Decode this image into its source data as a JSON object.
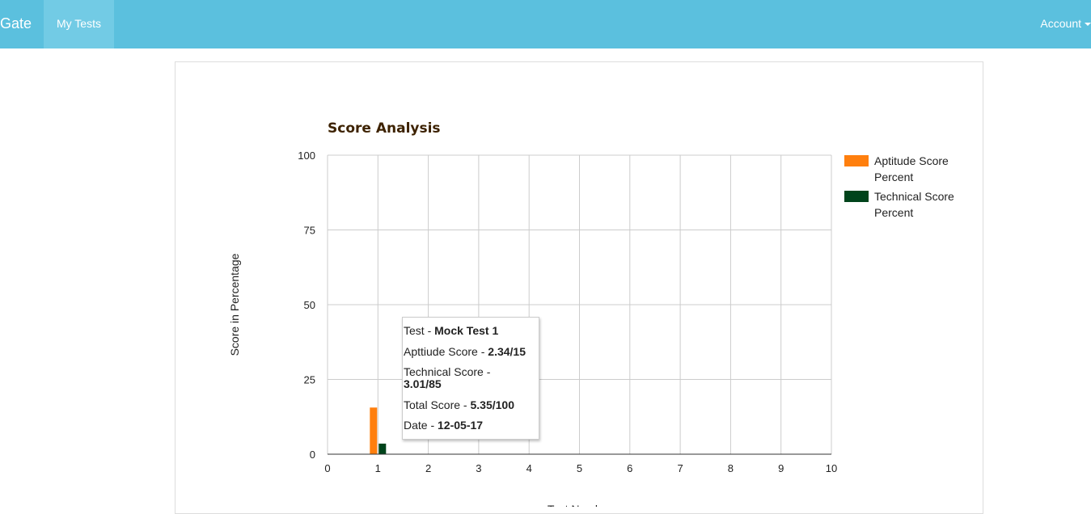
{
  "navbar": {
    "brand": "Gate",
    "items": [
      {
        "label": "My Tests"
      }
    ],
    "account_label": "Account"
  },
  "chart_data": {
    "type": "bar",
    "title": "Score Analysis",
    "xlabel": "Test Number",
    "ylabel": "Score in Percentage",
    "xlim": [
      0,
      10
    ],
    "ylim": [
      0,
      100
    ],
    "x_ticks": [
      0,
      1,
      2,
      3,
      4,
      5,
      6,
      7,
      8,
      9,
      10
    ],
    "y_ticks": [
      0,
      25,
      50,
      75,
      100
    ],
    "grid": true,
    "legend_position": "right",
    "series": [
      {
        "name": "Aptitude Score Percent",
        "color": "#ff7f0e",
        "x": [
          1
        ],
        "values": [
          15.6
        ]
      },
      {
        "name": "Technical Score Percent",
        "color": "#00441b",
        "x": [
          1
        ],
        "values": [
          3.54
        ]
      }
    ],
    "legend_lines": [
      [
        "Aptitude Score",
        "Percent"
      ],
      [
        "Technical Score",
        "Percent"
      ]
    ]
  },
  "tooltip": {
    "test_label": "Test - ",
    "test_value": "Mock Test 1",
    "aptitude_label": "Apttiude Score - ",
    "aptitude_value": "2.34/15",
    "technical_label": "Technical Score -",
    "technical_value": "3.01/85",
    "total_label": "Total Score - ",
    "total_value": "5.35/100",
    "date_label": "Date - ",
    "date_value": "12-05-17"
  }
}
